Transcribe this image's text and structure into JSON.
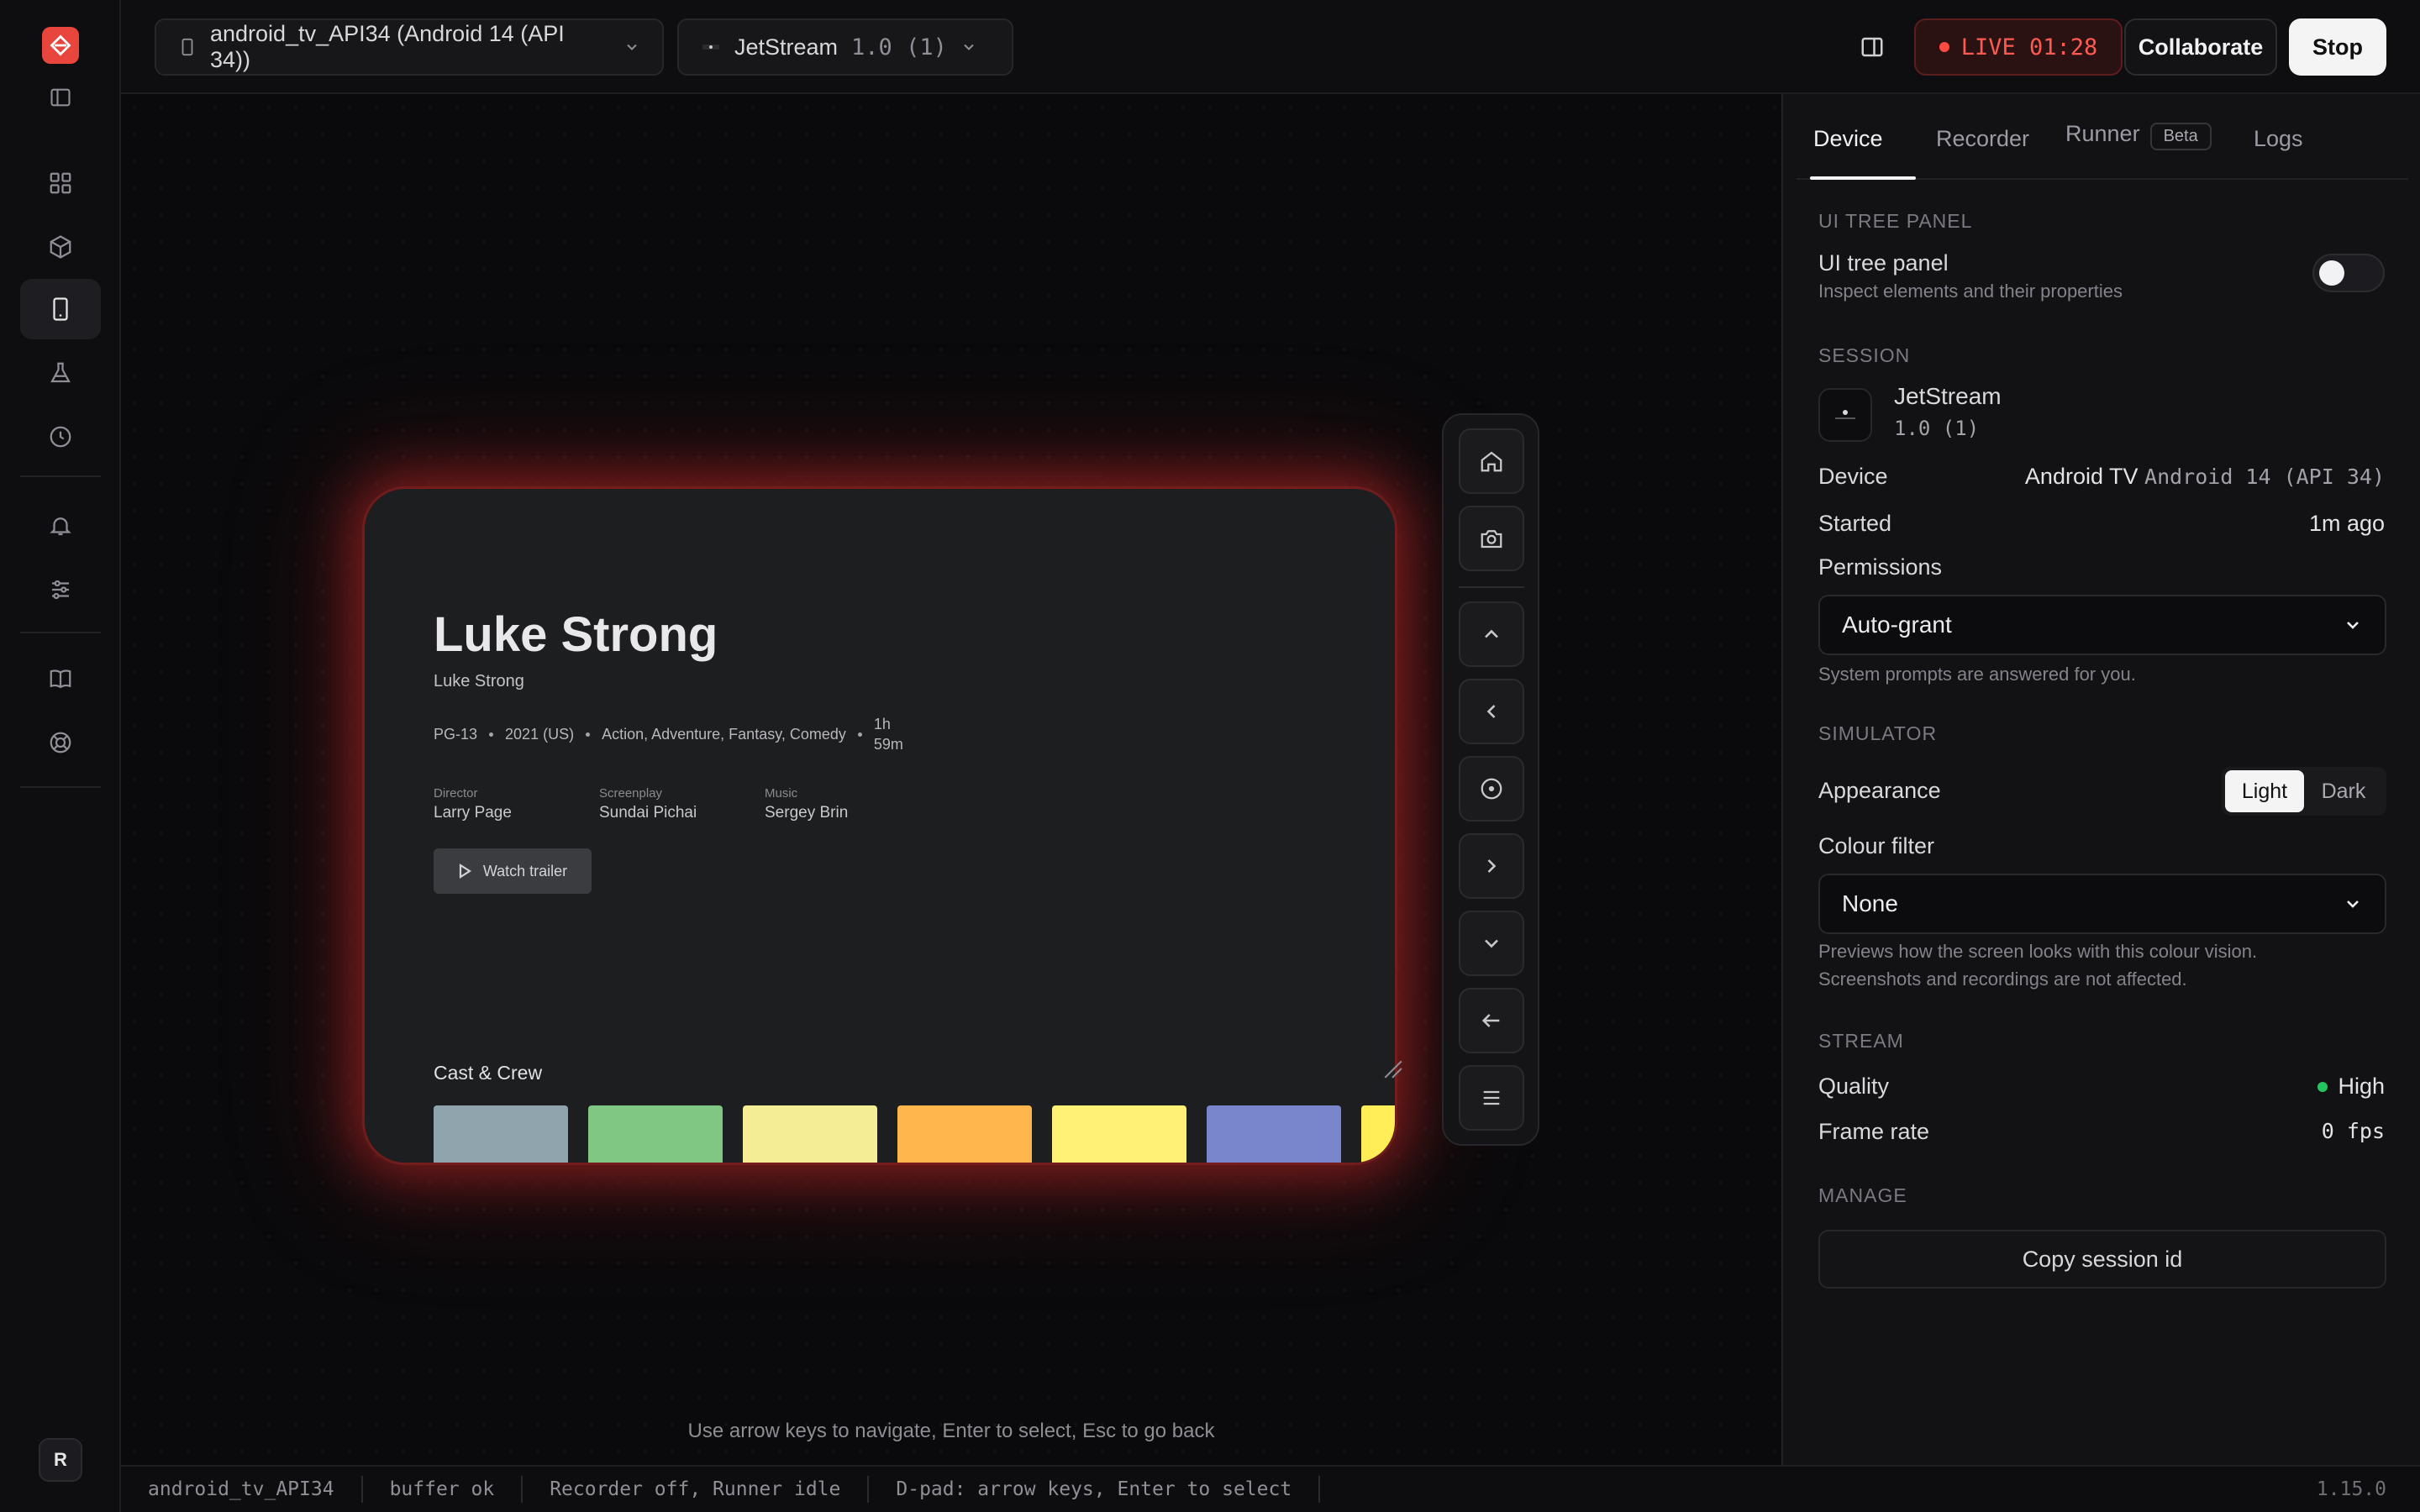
{
  "topbar": {
    "device_selector": "android_tv_API34 (Android 14 (API 34))",
    "app_name": "JetStream",
    "app_version": "1.0 (1)",
    "live_label": "LIVE 01:28",
    "collaborate_label": "Collaborate",
    "stop_label": "Stop"
  },
  "rail": {
    "avatar_initial": "R",
    "icons": [
      "sidebar-toggle-icon",
      "grid-icon",
      "cube-icon",
      "device-icon",
      "flask-icon",
      "clock-icon",
      "bell-icon",
      "sliders-icon",
      "book-icon",
      "lifebuoy-icon"
    ]
  },
  "tv": {
    "title": "Luke Strong",
    "subtitle": "Luke Strong",
    "rating": "PG-13",
    "year": "2021 (US)",
    "genres": "Action, Adventure, Fantasy, Comedy",
    "duration": "1h\n59m",
    "credits": [
      {
        "role": "Director",
        "name": "Larry Page"
      },
      {
        "role": "Screenplay",
        "name": "Sundai Pichai"
      },
      {
        "role": "Music",
        "name": "Sergey Brin"
      }
    ],
    "trailer_label": "Watch trailer",
    "cast_heading": "Cast & Crew",
    "tile_colors": [
      "#90a4ae",
      "#81c784",
      "#f4ed96",
      "#ffb74d",
      "#fff176",
      "#7986cb",
      "#ffee58"
    ]
  },
  "stage": {
    "hint": "Use arrow keys to navigate, Enter to select, Esc to go back"
  },
  "panel": {
    "tabs": [
      "Device",
      "Recorder",
      "Runner",
      "Logs"
    ],
    "beta_label": "Beta",
    "ui_tree": {
      "section": "UI TREE PANEL",
      "label": "UI tree panel",
      "desc": "Inspect elements and their properties",
      "enabled": false
    },
    "session": {
      "section": "SESSION",
      "app_name": "JetStream",
      "app_version": "1.0 (1)",
      "device_label": "Device",
      "device_name": "Android TV",
      "device_os": "Android 14 (API 34)",
      "started_label": "Started",
      "started_value": "1m ago",
      "permissions_label": "Permissions",
      "permissions_value": "Auto-grant",
      "permissions_desc": "System prompts are answered for you."
    },
    "simulator": {
      "section": "SIMULATOR",
      "appearance_label": "Appearance",
      "appearance_options": [
        "Light",
        "Dark"
      ],
      "appearance_selected": "Light",
      "filter_label": "Colour filter",
      "filter_value": "None",
      "filter_desc_1": "Previews how the screen looks with this colour vision.",
      "filter_desc_2": "Screenshots and recordings are not affected."
    },
    "stream": {
      "section": "STREAM",
      "quality_label": "Quality",
      "quality_value": "High",
      "quality_color": "#22c55e",
      "framerate_label": "Frame rate",
      "framerate_value": "0 fps"
    },
    "manage": {
      "section": "MANAGE",
      "copy_label": "Copy session id"
    }
  },
  "status": {
    "items": [
      "android_tv_API34",
      "buffer ok",
      "Recorder off, Runner idle",
      "D-pad: arrow keys, Enter to select"
    ],
    "version": "1.15.0"
  },
  "colors": {
    "accent": "#e8453c",
    "live": "#ff5a52"
  }
}
